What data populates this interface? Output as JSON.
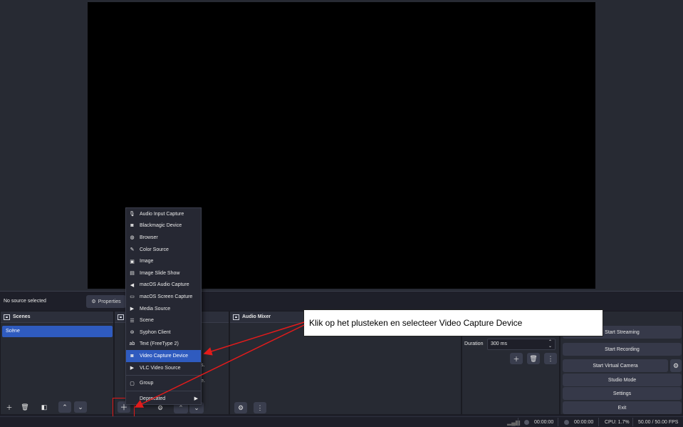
{
  "source_bar": {
    "no_source": "No source selected",
    "properties": "Properties"
  },
  "docks": {
    "scenes_title": "Scenes",
    "mixer_title": "Audio Mixer"
  },
  "scenes": [
    {
      "label": "Scène"
    }
  ],
  "context_menu": {
    "items": [
      {
        "label": "Audio Input Capture",
        "icon": "microphone-icon",
        "glyph": "🎙"
      },
      {
        "label": "Blackmagic Device",
        "icon": "camera-icon",
        "glyph": "◙"
      },
      {
        "label": "Browser",
        "icon": "globe-icon",
        "glyph": "◍"
      },
      {
        "label": "Color Source",
        "icon": "brush-icon",
        "glyph": "✎"
      },
      {
        "label": "Image",
        "icon": "image-icon",
        "glyph": "▣"
      },
      {
        "label": "Image Slide Show",
        "icon": "slideshow-icon",
        "glyph": "▤"
      },
      {
        "label": "macOS Audio Capture",
        "icon": "speaker-icon",
        "glyph": "◀"
      },
      {
        "label": "macOS Screen Capture",
        "icon": "monitor-icon",
        "glyph": "▭"
      },
      {
        "label": "Media Source",
        "icon": "play-icon",
        "glyph": "▶"
      },
      {
        "label": "Scene",
        "icon": "list-icon",
        "glyph": "☰"
      },
      {
        "label": "Syphon Client",
        "icon": "gamepad-icon",
        "glyph": "⊚"
      },
      {
        "label": "Text (FreeType 2)",
        "icon": "text-icon",
        "glyph": "ab"
      },
      {
        "label": "Video Capture Device",
        "icon": "camera-icon",
        "glyph": "◙",
        "selected": true
      },
      {
        "label": "VLC Video Source",
        "icon": "play-icon",
        "glyph": "▶"
      }
    ],
    "group": {
      "label": "Group",
      "icon": "folder-icon",
      "glyph": "▢"
    },
    "deprecated": {
      "label": "Deprecated"
    }
  },
  "hidden_fragments": {
    "frag1": "s.",
    "frag2": "e."
  },
  "transitions": {
    "duration_label": "Duration",
    "duration_value": "300 ms"
  },
  "controls": {
    "start_streaming": "Start Streaming",
    "start_recording": "Start Recording",
    "start_virtual_camera": "Start Virtual Camera",
    "studio_mode": "Studio Mode",
    "settings": "Settings",
    "exit": "Exit"
  },
  "annotation": {
    "text": "Klik op het plusteken en selecteer Video Capture Device",
    "color": "#e21b1b"
  },
  "status_bar": {
    "stream_time": "00:00:00",
    "record_time": "00:00:00",
    "cpu": "CPU: 1.7%",
    "fps": "50.00 / 50.00 FPS"
  }
}
